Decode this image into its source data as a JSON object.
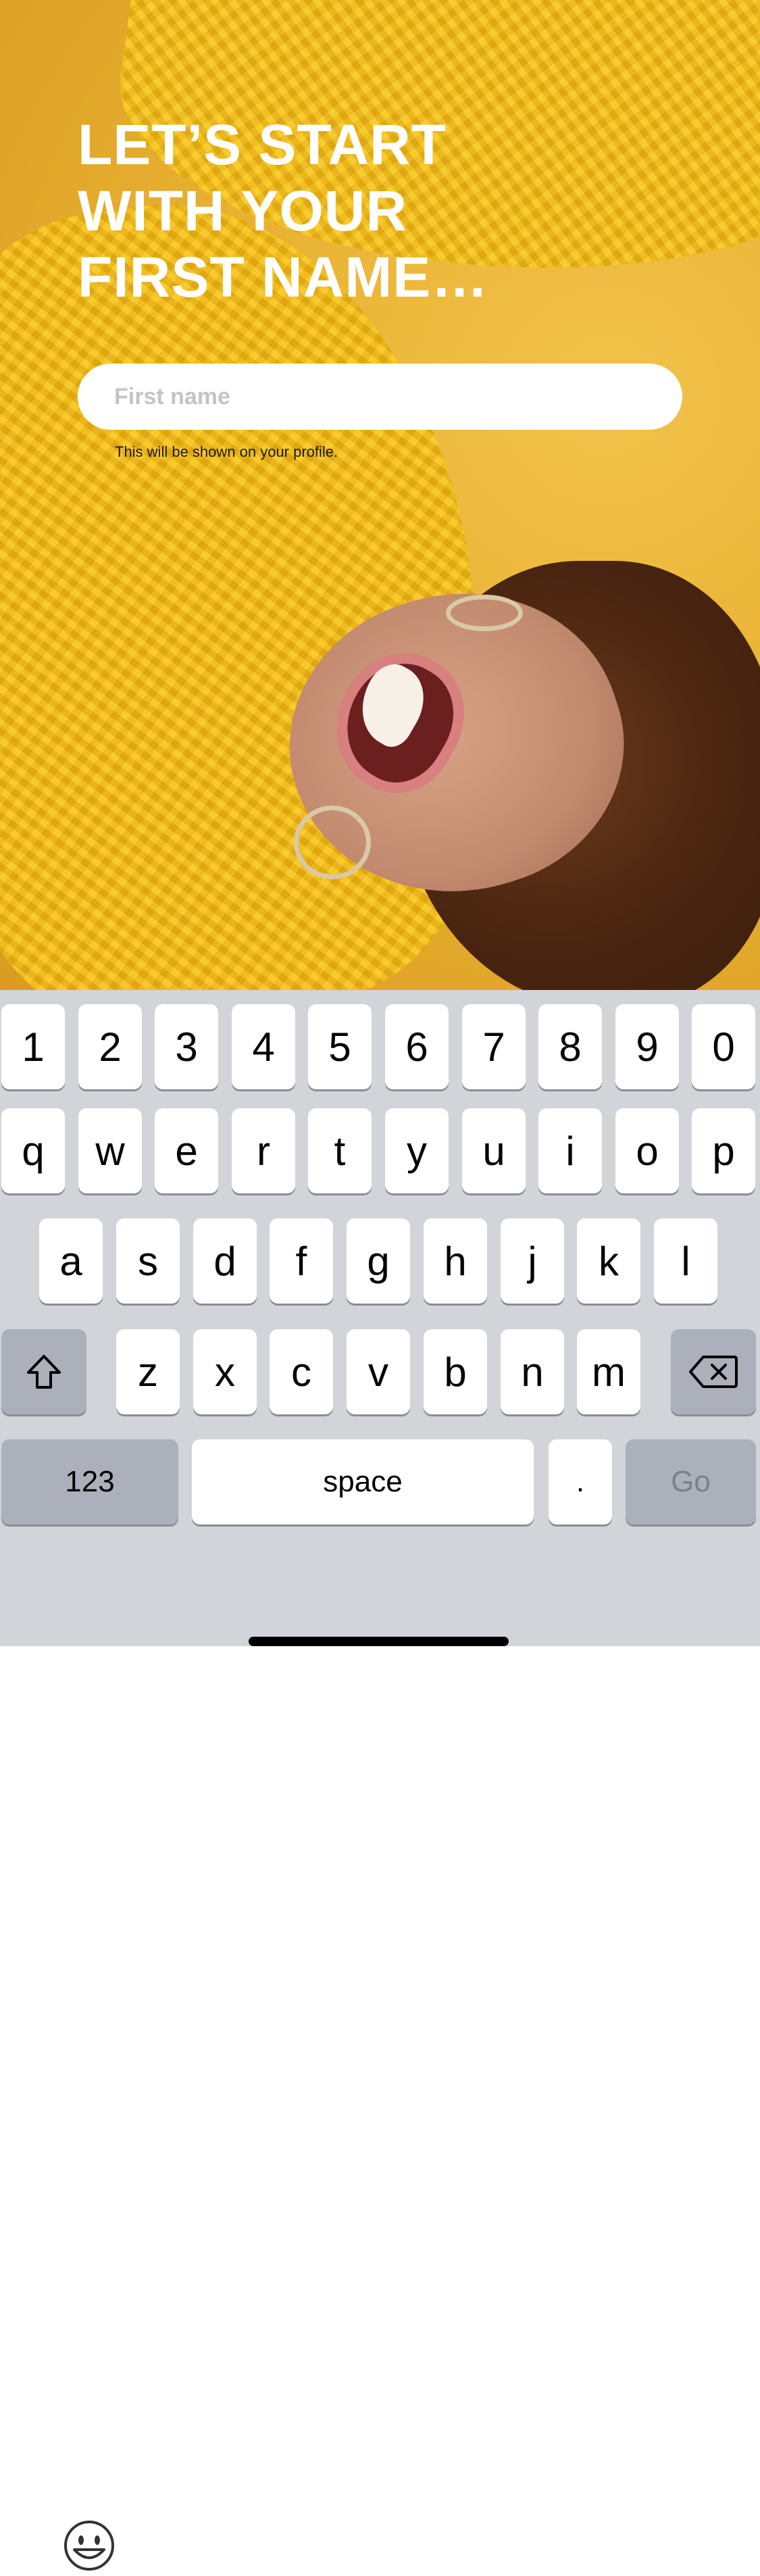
{
  "heading": "LET’S START\nWITH YOUR\nFIRST NAME…",
  "input": {
    "placeholder": "First name",
    "value": ""
  },
  "helper_text": "This will be shown on your profile.",
  "keyboard": {
    "row1": [
      "1",
      "2",
      "3",
      "4",
      "5",
      "6",
      "7",
      "8",
      "9",
      "0"
    ],
    "row2": [
      "q",
      "w",
      "e",
      "r",
      "t",
      "y",
      "u",
      "i",
      "o",
      "p"
    ],
    "row3": [
      "a",
      "s",
      "d",
      "f",
      "g",
      "h",
      "j",
      "k",
      "l"
    ],
    "row4": [
      "z",
      "x",
      "c",
      "v",
      "b",
      "n",
      "m"
    ],
    "numbers_label": "123",
    "space_label": "space",
    "period_label": ".",
    "go_label": "Go",
    "shift_icon": "shift-icon",
    "delete_icon": "backspace-icon",
    "emoji_icon": "emoji-icon"
  },
  "colors": {
    "background_yellow": "#e9b233",
    "keyboard_bg": "#d1d4d9",
    "key_bg": "#ffffff",
    "dark_key_bg": "#abb0ba"
  }
}
